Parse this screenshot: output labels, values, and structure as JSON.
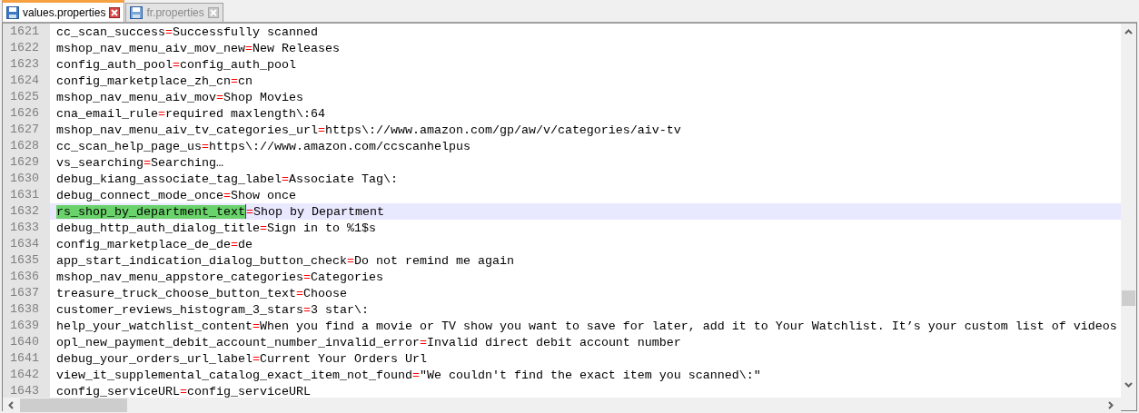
{
  "tabs": [
    {
      "label": "values.properties",
      "selected": true
    },
    {
      "label": "fr.properties",
      "selected": false
    }
  ],
  "lines": [
    {
      "number": "1621",
      "key": "cc_scan_success",
      "equals": "=",
      "value": "Successfully scanned",
      "current": false,
      "key_selected": false
    },
    {
      "number": "1622",
      "key": "mshop_nav_menu_aiv_mov_new",
      "equals": "=",
      "value": "New Releases",
      "current": false,
      "key_selected": false
    },
    {
      "number": "1623",
      "key": "config_auth_pool",
      "equals": "=",
      "value": "config_auth_pool",
      "current": false,
      "key_selected": false
    },
    {
      "number": "1624",
      "key": "config_marketplace_zh_cn",
      "equals": "=",
      "value": "cn",
      "current": false,
      "key_selected": false
    },
    {
      "number": "1625",
      "key": "mshop_nav_menu_aiv_mov",
      "equals": "=",
      "value": "Shop Movies",
      "current": false,
      "key_selected": false
    },
    {
      "number": "1626",
      "key": "cna_email_rule",
      "equals": "=",
      "value": "required maxlength\\:64",
      "current": false,
      "key_selected": false
    },
    {
      "number": "1627",
      "key": "mshop_nav_menu_aiv_tv_categories_url",
      "equals": "=",
      "value": "https\\://www.amazon.com/gp/aw/v/categories/aiv-tv",
      "current": false,
      "key_selected": false
    },
    {
      "number": "1628",
      "key": "cc_scan_help_page_us",
      "equals": "=",
      "value": "https\\://www.amazon.com/ccscanhelpus",
      "current": false,
      "key_selected": false
    },
    {
      "number": "1629",
      "key": "vs_searching",
      "equals": "=",
      "value": "Searching…",
      "current": false,
      "key_selected": false
    },
    {
      "number": "1630",
      "key": "debug_kiang_associate_tag_label",
      "equals": "=",
      "value": "Associate Tag\\:",
      "current": false,
      "key_selected": false
    },
    {
      "number": "1631",
      "key": "debug_connect_mode_once",
      "equals": "=",
      "value": "Show once",
      "current": false,
      "key_selected": false
    },
    {
      "number": "1632",
      "key": "rs_shop_by_department_text",
      "equals": "=",
      "value": "Shop by Department",
      "current": true,
      "key_selected": true
    },
    {
      "number": "1633",
      "key": "debug_http_auth_dialog_title",
      "equals": "=",
      "value": "Sign in to %1$s",
      "current": false,
      "key_selected": false
    },
    {
      "number": "1634",
      "key": "config_marketplace_de_de",
      "equals": "=",
      "value": "de",
      "current": false,
      "key_selected": false
    },
    {
      "number": "1635",
      "key": "app_start_indication_dialog_button_check",
      "equals": "=",
      "value": "Do not remind me again",
      "current": false,
      "key_selected": false
    },
    {
      "number": "1636",
      "key": "mshop_nav_menu_appstore_categories",
      "equals": "=",
      "value": "Categories",
      "current": false,
      "key_selected": false
    },
    {
      "number": "1637",
      "key": "treasure_truck_choose_button_text",
      "equals": "=",
      "value": "Choose",
      "current": false,
      "key_selected": false
    },
    {
      "number": "1638",
      "key": "customer_reviews_histogram_3_stars",
      "equals": "=",
      "value": "3 star\\:",
      "current": false,
      "key_selected": false
    },
    {
      "number": "1639",
      "key": "help_your_watchlist_content",
      "equals": "=",
      "value": "When you find a movie or TV show you want to save for later, add it to Your Watchlist. It’s your custom list of videos",
      "current": false,
      "key_selected": false
    },
    {
      "number": "1640",
      "key": "opl_new_payment_debit_account_number_invalid_error",
      "equals": "=",
      "value": "Invalid direct debit account number",
      "current": false,
      "key_selected": false
    },
    {
      "number": "1641",
      "key": "debug_your_orders_url_label",
      "equals": "=",
      "value": "Current Your Orders Url",
      "current": false,
      "key_selected": false
    },
    {
      "number": "1642",
      "key": "view_it_supplemental_catalog_exact_item_not_found",
      "equals": "=",
      "value": "\"We couldn't find the exact item you scanned\\:\"",
      "current": false,
      "key_selected": false
    },
    {
      "number": "1643",
      "key": "config_serviceURL",
      "equals": "=",
      "value": "config_serviceURL",
      "current": false,
      "key_selected": false
    }
  ]
}
